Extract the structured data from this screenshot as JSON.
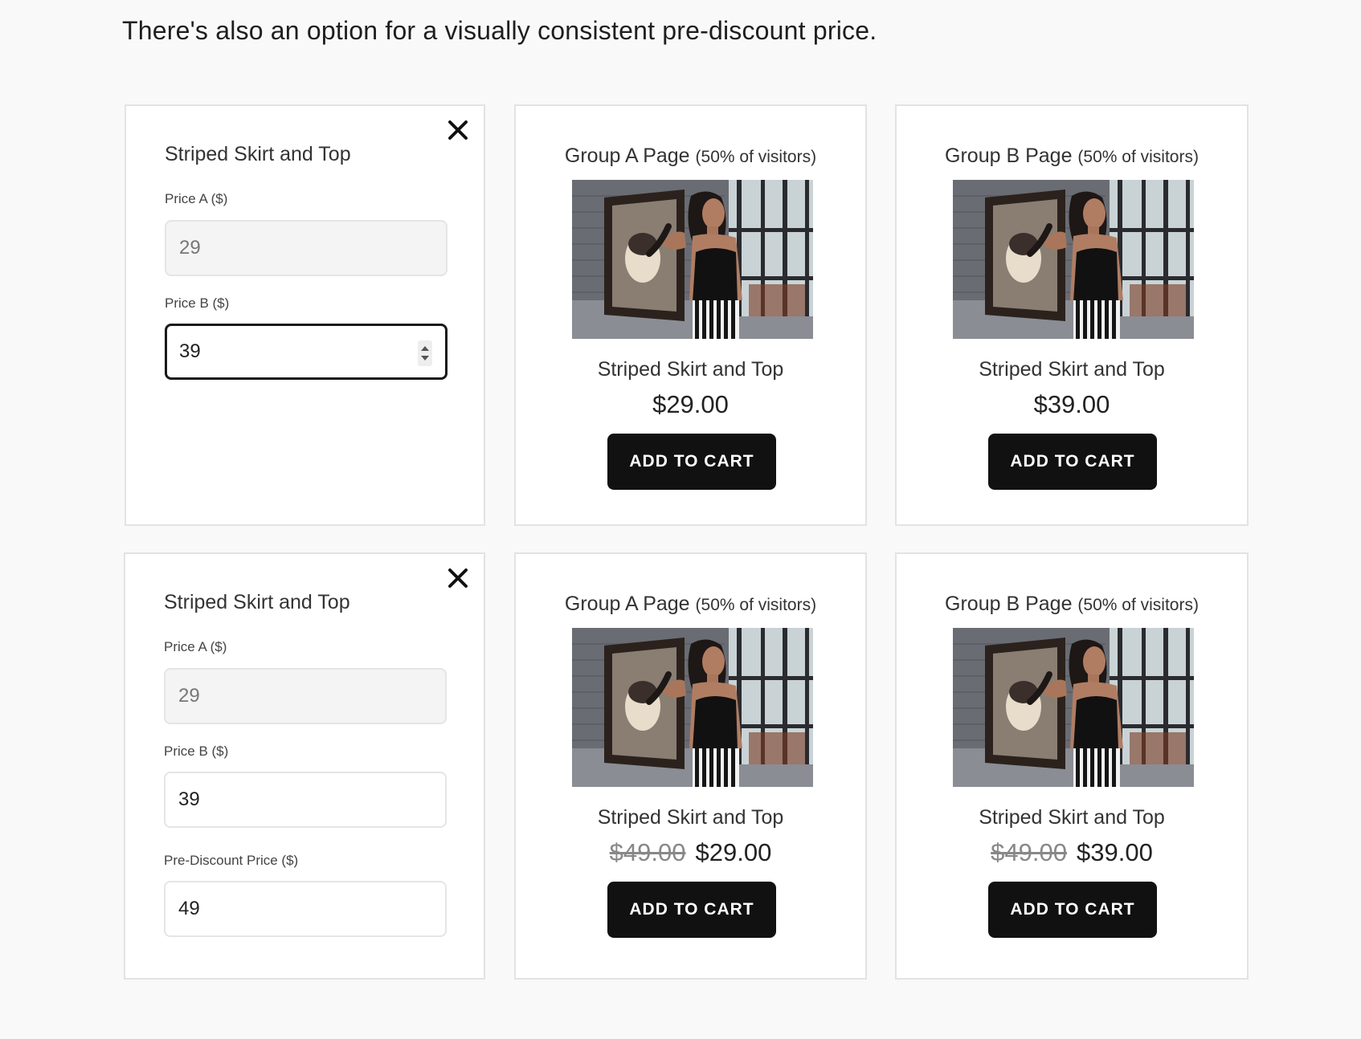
{
  "intro_text": "There's also an option for a visually consistent pre-discount price.",
  "icons": {
    "close": "close-icon",
    "spinner": "number-spinner-icon"
  },
  "colors": {
    "button_bg": "#111111",
    "button_text": "#ffffff",
    "focus_border": "#1a1a1a",
    "page_bg": "#f9f9f9"
  },
  "rows": [
    {
      "editor": {
        "product_title": "Striped Skirt and Top",
        "price_a_label": "Price A ($)",
        "price_a_value": "29",
        "price_b_label": "Price B ($)",
        "price_b_value": "39"
      },
      "group_a": {
        "title": "Group A Page",
        "subtitle": "(50% of visitors)",
        "product_name": "Striped Skirt and Top",
        "price": "$29.00",
        "button_label": "ADD TO CART"
      },
      "group_b": {
        "title": "Group B Page",
        "subtitle": "(50% of visitors)",
        "product_name": "Striped Skirt and Top",
        "price": "$39.00",
        "button_label": "ADD TO CART"
      }
    },
    {
      "editor": {
        "product_title": "Striped Skirt and Top",
        "price_a_label": "Price A ($)",
        "price_a_value": "29",
        "price_b_label": "Price B ($)",
        "price_b_value": "39",
        "pre_discount_label": "Pre-Discount Price ($)",
        "pre_discount_value": "49"
      },
      "group_a": {
        "title": "Group A Page",
        "subtitle": "(50% of visitors)",
        "product_name": "Striped Skirt and Top",
        "old_price": "$49.00",
        "price": "$29.00",
        "button_label": "ADD TO CART"
      },
      "group_b": {
        "title": "Group B Page",
        "subtitle": "(50% of visitors)",
        "product_name": "Striped Skirt and Top",
        "old_price": "$49.00",
        "price": "$39.00",
        "button_label": "ADD TO CART"
      }
    }
  ]
}
